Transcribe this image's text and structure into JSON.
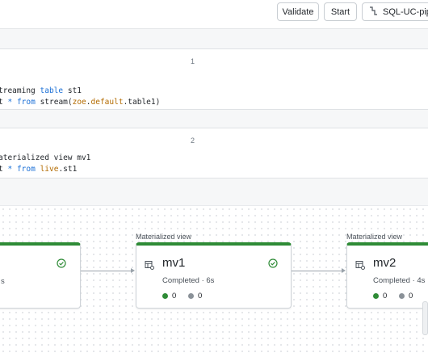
{
  "toolbar": {
    "validate_label": "Validate",
    "start_label": "Start",
    "pipeline_label": "SQL-UC-pipe"
  },
  "cells": [
    {
      "number": "1",
      "line1": {
        "frag_a": "treaming",
        "kw1": "table",
        "frag_b": "st1"
      },
      "line2": {
        "frag_a": "t",
        "op": "*",
        "kw1": "from",
        "call": "stream(",
        "str1": "zoe",
        "sep1": ".",
        "str2": "default",
        "rest": ".table1)"
      }
    },
    {
      "number": "2",
      "line1": {
        "text": "aterialized view mv1"
      },
      "line2": {
        "frag_a": "t",
        "op": "*",
        "kw1": "from",
        "str1": "live",
        "rest": ".st1"
      }
    }
  ],
  "dag": {
    "nodes": [
      {
        "caption": "",
        "name": "",
        "status": "s",
        "state": "completed"
      },
      {
        "caption": "Materialized view",
        "name": "mv1",
        "status": "Completed · 6s",
        "metric_green": "0",
        "metric_gray": "0",
        "state": "completed"
      },
      {
        "caption": "Materialized view",
        "name": "mv2",
        "status": "Completed · 4s",
        "metric_green": "0",
        "metric_gray": "0",
        "state": "completed"
      }
    ]
  },
  "colors": {
    "success": "#2e8b36",
    "keyword": "#1a6fd6",
    "string": "#b36b00",
    "edge": "#9aa3ab"
  },
  "icons": {
    "pipeline": "pipeline-icon",
    "materialized_view": "table-view-icon",
    "completed": "check-circle-icon"
  }
}
